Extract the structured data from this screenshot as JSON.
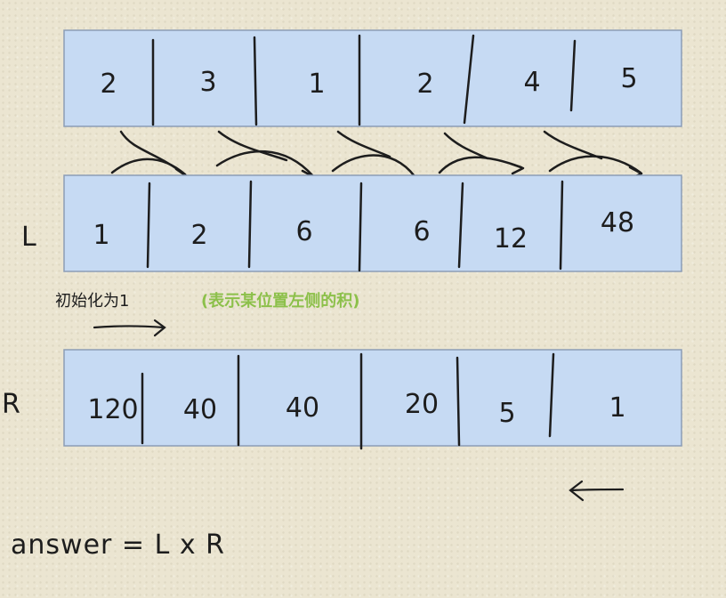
{
  "rows": {
    "nums": {
      "label": "",
      "values": [
        "2",
        "3",
        "1",
        "2",
        "4",
        "5"
      ]
    },
    "left": {
      "label": "L",
      "values": [
        "1",
        "2",
        "6",
        "6",
        "12",
        "48"
      ]
    },
    "right": {
      "label": "R",
      "values": [
        "120",
        "40",
        "40",
        "20",
        "5",
        "1"
      ]
    }
  },
  "notes": {
    "init": "初始化为1",
    "explanation": "(表示某位置左侧的积)"
  },
  "answer": "answer = L x R",
  "colors": {
    "cell_fill": "#c6daf3",
    "cell_border": "#8c9db6",
    "ink": "#1d1d1d",
    "green_note": "#8cc04a"
  },
  "icons": {
    "left_to_right": "arrow-right-icon",
    "right_to_left": "arrow-left-icon"
  }
}
